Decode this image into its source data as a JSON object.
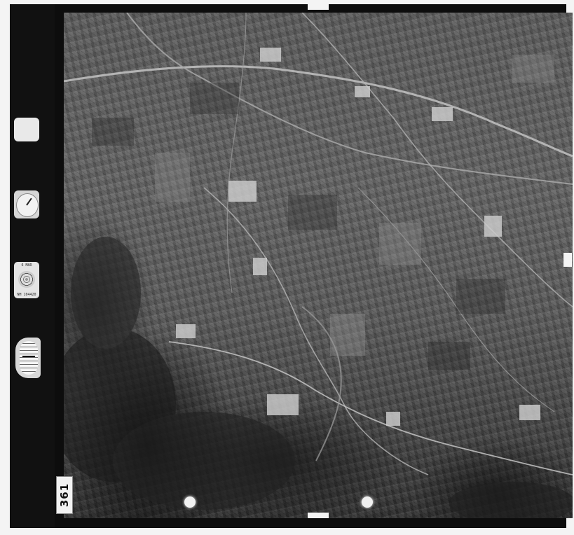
{
  "image": {
    "kind": "aerial survey photograph",
    "tone": "black-and-white"
  },
  "frame_number": "361",
  "instrument_panel": {
    "lens_label_top": "6 MAR",
    "lens_label_bottom": "NH 104420"
  },
  "icons": [
    "blank-card-icon",
    "clock-icon",
    "lens-dial-icon",
    "altimeter-icon"
  ],
  "colors": {
    "film_border": "#0d0d0d",
    "paper": "#f4f4f4",
    "terrain_mid": "#5a5a5a",
    "roads": "#bdbdbd"
  }
}
